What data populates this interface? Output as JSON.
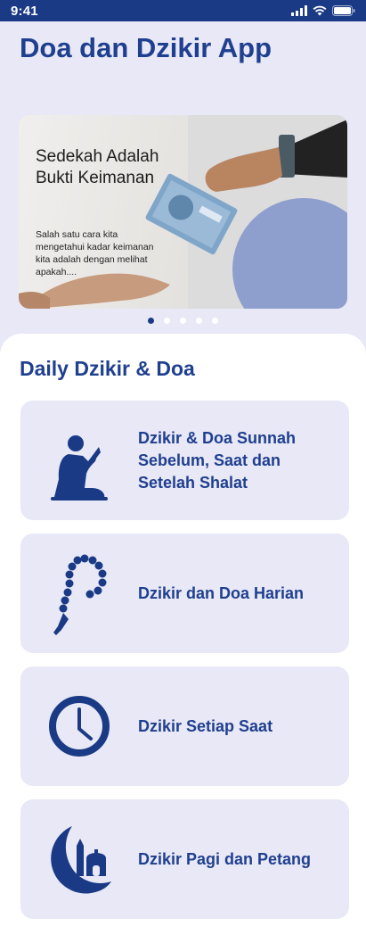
{
  "status_bar": {
    "time": "9:41"
  },
  "header": {
    "title": "Doa dan Dzikir App"
  },
  "banner": {
    "headline": "Sedekah Adalah Bukti Keimanan",
    "body": "Salah satu cara kita mengetahui kadar keimanan kita adalah dengan melihat apakah....",
    "accent_color": "#8e9fcd"
  },
  "carousel": {
    "pages": 5,
    "active_index": 0
  },
  "section": {
    "title": "Daily Dzikir & Doa"
  },
  "menu": {
    "items": [
      {
        "label": "Dzikir & Doa Sunnah Sebelum, Saat dan Setelah Shalat",
        "icon": "praying-person-icon"
      },
      {
        "label": "Dzikir dan Doa Harian",
        "icon": "prayer-beads-icon"
      },
      {
        "label": "Dzikir Setiap Saat",
        "icon": "clock-icon"
      },
      {
        "label": "Dzikir Pagi dan Petang",
        "icon": "crescent-mosque-icon"
      }
    ]
  },
  "colors": {
    "primary": "#1f3f8f",
    "status_bar": "#1a3a86",
    "card_bg": "#e8e8f6",
    "page_bg": "#e8e8f6"
  }
}
